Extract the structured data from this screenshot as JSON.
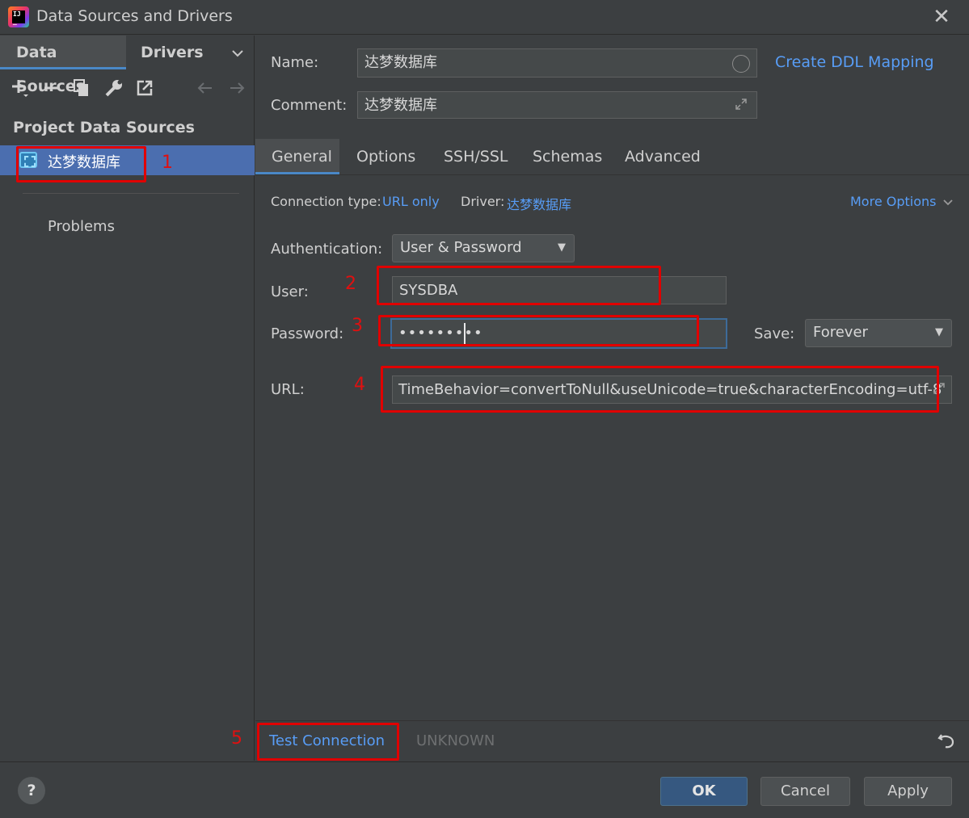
{
  "window": {
    "title": "Data Sources and Drivers",
    "close_glyph": "✕"
  },
  "left": {
    "tabs": [
      "Data Sources",
      "Drivers"
    ],
    "toolbar_icons": [
      "add-icon",
      "remove-icon",
      "duplicate-icon",
      "wrench-icon",
      "jump-icon",
      "back-icon",
      "forward-icon"
    ],
    "section_title": "Project Data Sources",
    "data_source": "达梦数据库",
    "problems": "Problems"
  },
  "form": {
    "name_label": "Name:",
    "name_value": "达梦数据库",
    "comment_label": "Comment:",
    "comment_value": "达梦数据库",
    "create_ddl": "Create DDL Mapping",
    "tabs": [
      "General",
      "Options",
      "SSH/SSL",
      "Schemas",
      "Advanced"
    ],
    "connection_type_label": "Connection type:",
    "connection_type": "URL only",
    "driver_label": "Driver:",
    "driver": "达梦数据库",
    "more_options": "More Options",
    "auth_label": "Authentication:",
    "auth_value": "User & Password",
    "user_label": "User:",
    "user_value": "SYSDBA",
    "password_label": "Password:",
    "password_masked": "•••••••••",
    "save_label": "Save:",
    "save_value": "Forever",
    "url_label": "URL:",
    "url_value": "TimeBehavior=convertToNull&useUnicode=true&characterEncoding=utf-8"
  },
  "test": {
    "button": "Test Connection",
    "status": "UNKNOWN"
  },
  "footer": {
    "help": "?",
    "ok": "OK",
    "cancel": "Cancel",
    "apply": "Apply"
  },
  "annotations": [
    "1",
    "2",
    "3",
    "4",
    "5"
  ],
  "colors": {
    "accent": "#589df6",
    "selection": "#4b6eaf",
    "annotation": "#e00000",
    "background": "#3c3f41"
  }
}
